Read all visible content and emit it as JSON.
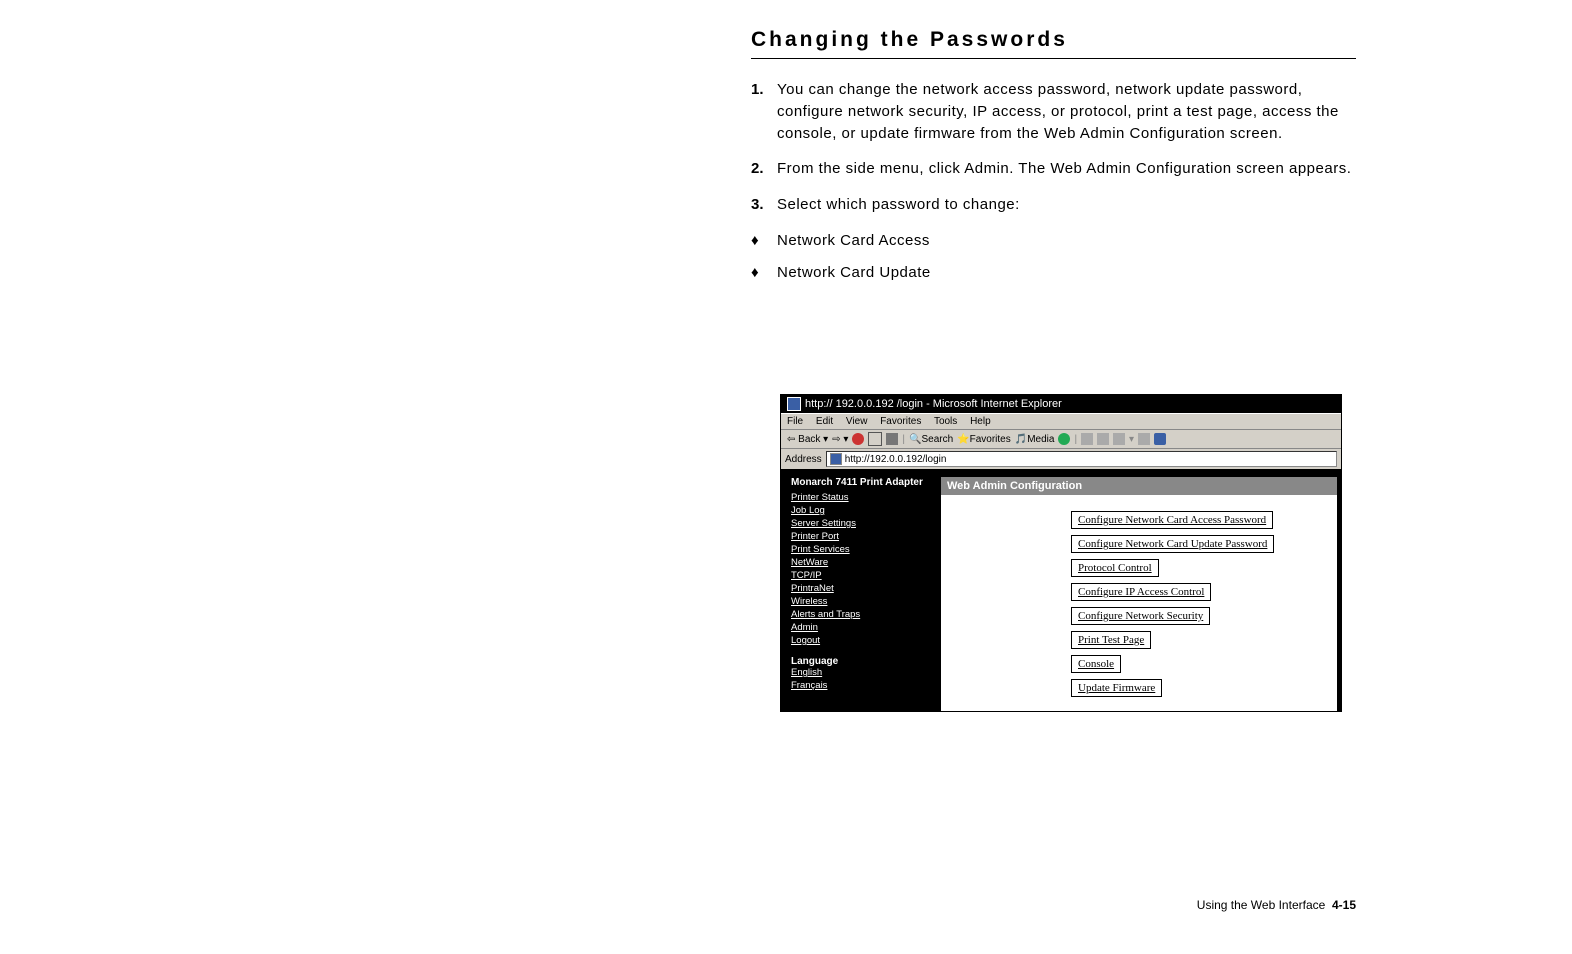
{
  "section_title": "Changing the Passwords",
  "steps": [
    "You can change the network access password, network update password, configure network security, IP access, or protocol, print a test page, access the console, or update firmware from the Web Admin Configuration screen.",
    "From the side menu, click Admin. The Web Admin Configuration screen appears.",
    "Select which password to change:"
  ],
  "bullets": [
    "Network Card Access",
    "Network Card Update"
  ],
  "browser": {
    "title": "http:// 192.0.0.192 /login - Microsoft Internet Explorer",
    "menus": [
      "File",
      "Edit",
      "View",
      "Favorites",
      "Tools",
      "Help"
    ],
    "toolbar": {
      "back": "Back",
      "search": "Search",
      "favorites": "Favorites",
      "media": "Media"
    },
    "address_label": "Address",
    "address_value": "http://192.0.0.192/login"
  },
  "sidebar": {
    "header": "Monarch 7411 Print Adapter",
    "items": [
      "Printer Status",
      "Job Log",
      "Server Settings",
      "Printer Port",
      "Print Services",
      "NetWare",
      "TCP/IP",
      "PrintraNet",
      "Wireless",
      "Alerts and Traps",
      "Admin",
      "Logout"
    ],
    "language_header": "Language",
    "languages": [
      "English",
      "Français"
    ]
  },
  "mainpane": {
    "title": "Web Admin Configuration",
    "links": [
      "Configure Network Card Access Password",
      "Configure Network Card Update Password",
      "Protocol Control",
      "Configure IP Access Control",
      "Configure Network Security",
      "Print Test Page",
      "Console",
      "Update Firmware"
    ]
  },
  "footer": {
    "text": "Using the Web Interface",
    "page": "4-15"
  }
}
